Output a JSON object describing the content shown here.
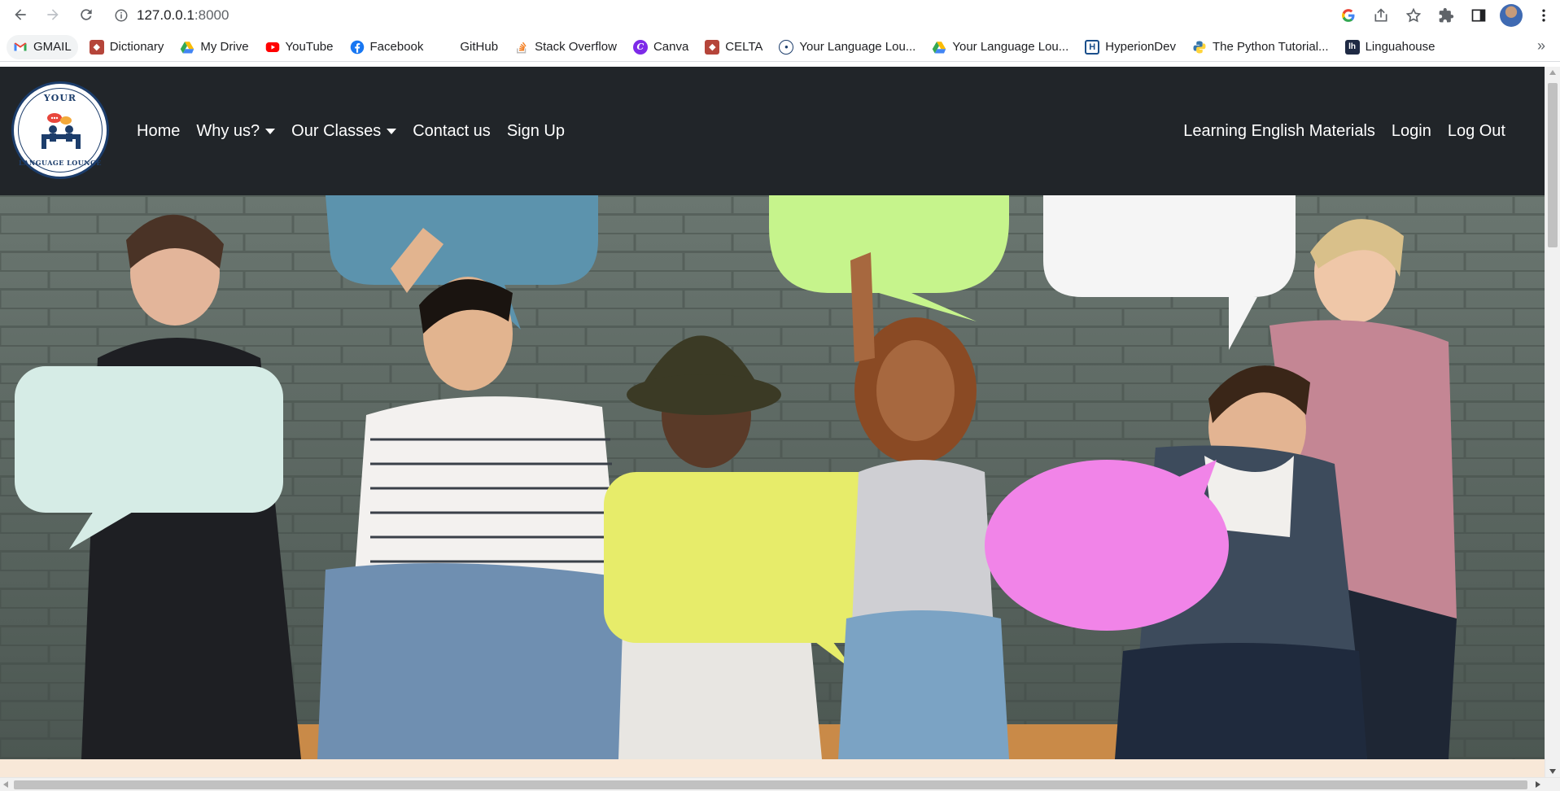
{
  "browser": {
    "url_host": "127.0.0.1",
    "url_port": ":8000"
  },
  "bookmarks": [
    {
      "label": "GMAIL",
      "icon": "gmail-icon",
      "color": "#ea4335"
    },
    {
      "label": "Dictionary",
      "icon": "cambridge-icon",
      "color": "#b5453a"
    },
    {
      "label": "My Drive",
      "icon": "drive-icon",
      "color": "#34a853"
    },
    {
      "label": "YouTube",
      "icon": "youtube-icon",
      "color": "#ff0000"
    },
    {
      "label": "Facebook",
      "icon": "facebook-icon",
      "color": "#1877f2"
    },
    {
      "label": "GitHub",
      "icon": "github-icon",
      "color": "#ffffff"
    },
    {
      "label": "Stack Overflow",
      "icon": "stackoverflow-icon",
      "color": "#f48024"
    },
    {
      "label": "Canva",
      "icon": "canva-icon",
      "color": "#00c4cc"
    },
    {
      "label": "CELTA",
      "icon": "cambridge-icon",
      "color": "#b5453a"
    },
    {
      "label": "Your Language Lou...",
      "icon": "site-logo-icon",
      "color": "#1c3d6b"
    },
    {
      "label": "Your Language Lou...",
      "icon": "drive-icon",
      "color": "#34a853"
    },
    {
      "label": "HyperionDev",
      "icon": "hyperiondev-icon",
      "color": "#1a4f8b"
    },
    {
      "label": "The Python Tutorial...",
      "icon": "python-icon",
      "color": "#3776ab"
    },
    {
      "label": "Linguahouse",
      "icon": "linguahouse-icon",
      "color": "#1f2a44"
    }
  ],
  "navbar": {
    "logo_top": "YOUR",
    "logo_bottom": "LANGUAGE LOUNGE",
    "left": [
      {
        "label": "Home",
        "dropdown": false
      },
      {
        "label": "Why us?",
        "dropdown": true
      },
      {
        "label": "Our Classes",
        "dropdown": true
      },
      {
        "label": "Contact us",
        "dropdown": false
      },
      {
        "label": "Sign Up",
        "dropdown": false
      }
    ],
    "right": [
      {
        "label": "Learning English Materials"
      },
      {
        "label": "Login"
      },
      {
        "label": "Log Out"
      }
    ]
  },
  "colors": {
    "navbar_bg": "#212529",
    "strip_bg": "#f8e8d8"
  }
}
